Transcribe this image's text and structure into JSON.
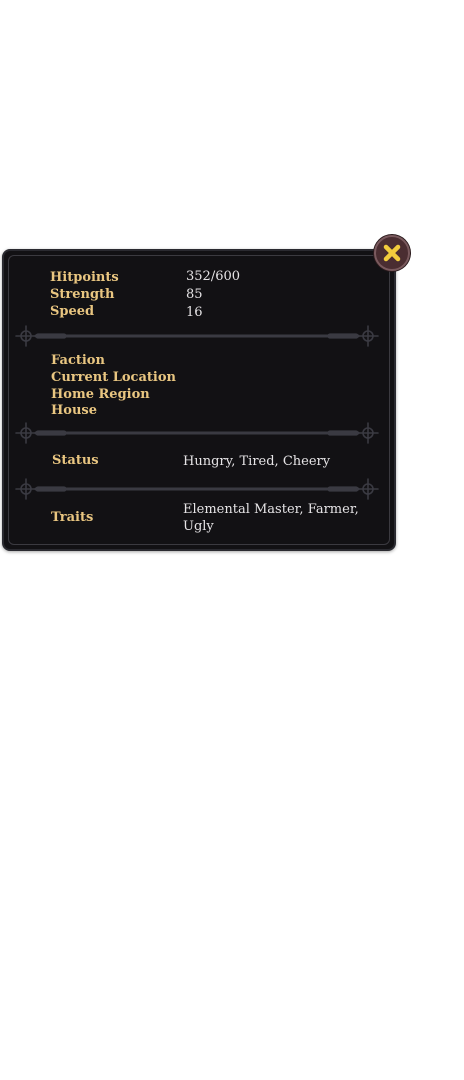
{
  "stats": {
    "hitpoints": {
      "label": "Hitpoints",
      "value": "352/600"
    },
    "strength": {
      "label": "Strength",
      "value": "85"
    },
    "speed": {
      "label": "Speed",
      "value": "16"
    }
  },
  "info": {
    "faction_label": "Faction",
    "current_location_label": "Current Location",
    "home_region_label": "Home Region",
    "house_label": "House"
  },
  "status": {
    "label": "Status",
    "value": "Hungry, Tired, Cheery"
  },
  "traits": {
    "label": "Traits",
    "value_line1": "Elemental Master, Farmer,",
    "value_line2": "Ugly"
  },
  "icons": {
    "close": "close-icon",
    "divider": "ornate-divider"
  },
  "colors": {
    "panel_bg": "#121114",
    "label": "#e9c681",
    "value": "#e6e4e6",
    "close_x": "#f2cc3d"
  }
}
